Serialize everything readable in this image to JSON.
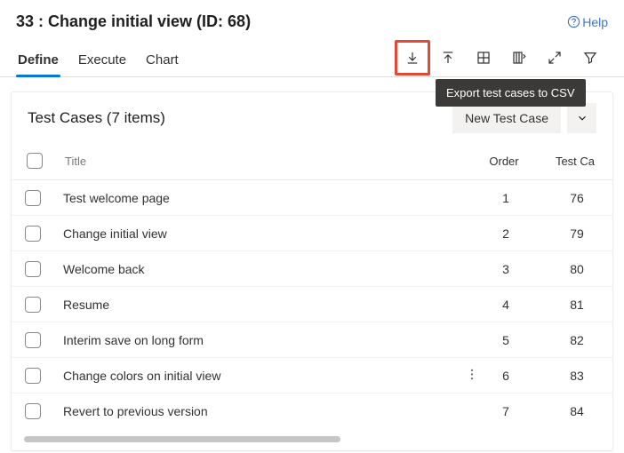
{
  "header": {
    "title": "33 : Change initial view (ID: 68)",
    "help": "Help"
  },
  "tabs": {
    "define": "Define",
    "execute": "Execute",
    "chart": "Chart"
  },
  "toolbar": {
    "export_tooltip": "Export test cases to CSV"
  },
  "panel": {
    "title": "Test Cases (7 items)",
    "new_button": "New Test Case",
    "columns": {
      "title": "Title",
      "order": "Order",
      "tc": "Test Ca"
    },
    "rows": [
      {
        "title": "Test welcome page",
        "order": "1",
        "tc": "76",
        "menu": false
      },
      {
        "title": "Change initial view",
        "order": "2",
        "tc": "79",
        "menu": false
      },
      {
        "title": "Welcome back",
        "order": "3",
        "tc": "80",
        "menu": false
      },
      {
        "title": "Resume",
        "order": "4",
        "tc": "81",
        "menu": false
      },
      {
        "title": "Interim save on long form",
        "order": "5",
        "tc": "82",
        "menu": false
      },
      {
        "title": "Change colors on initial view",
        "order": "6",
        "tc": "83",
        "menu": true
      },
      {
        "title": "Revert to previous version",
        "order": "7",
        "tc": "84",
        "menu": false
      }
    ]
  }
}
